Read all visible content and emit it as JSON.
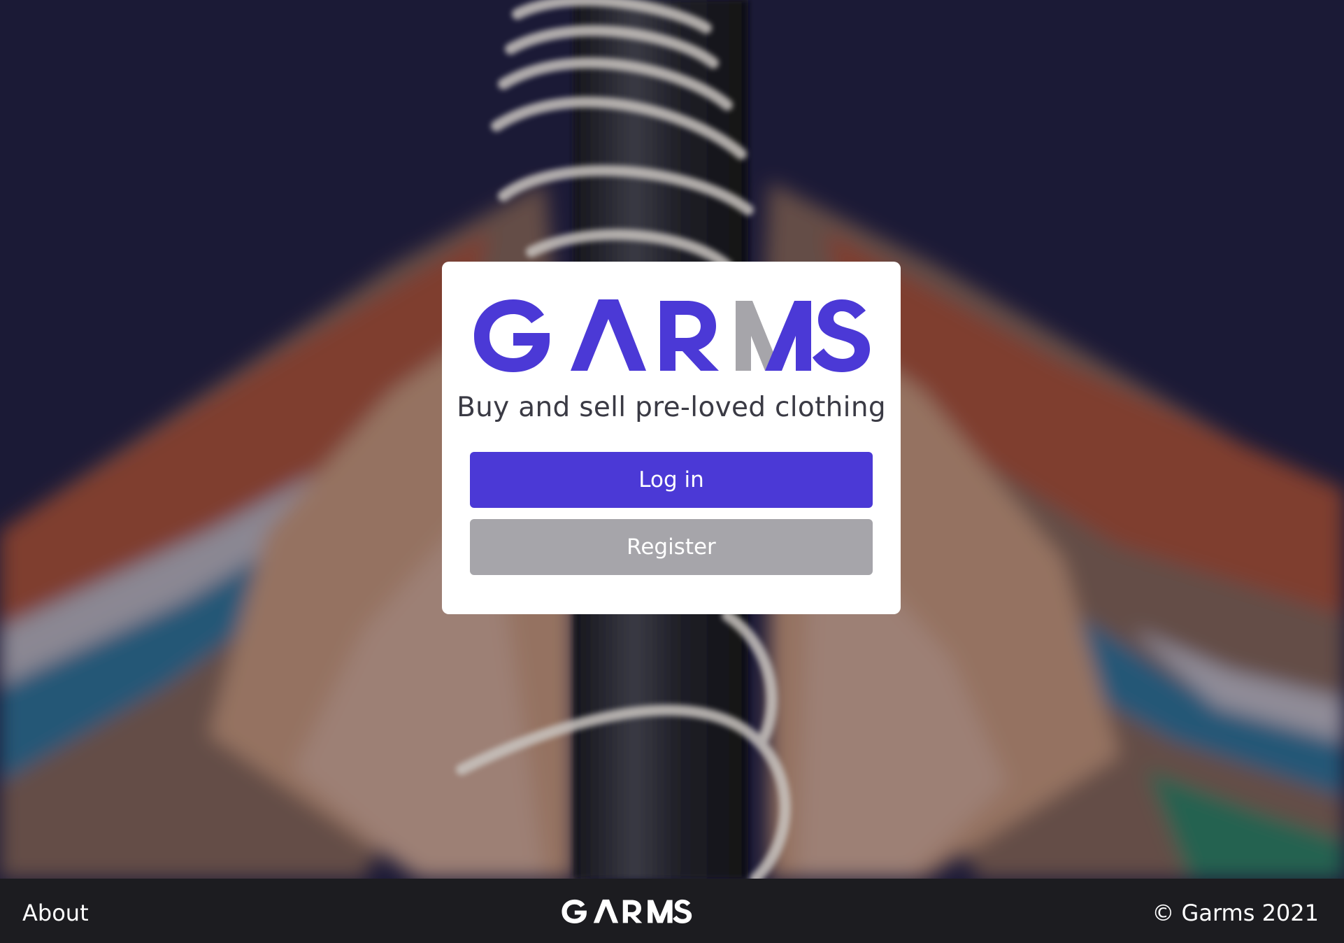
{
  "brand": {
    "logo_text": "GARMS",
    "primary_color": "#4b39d6",
    "accent_gray": "#a6a5aa"
  },
  "card": {
    "tagline": "Buy and sell pre-loved clothing",
    "login_label": "Log in",
    "register_label": "Register"
  },
  "footer": {
    "about_label": "About",
    "logo_text": "GARMS",
    "copyright": "© Garms 2021"
  },
  "hero": {
    "description_icon": "clothes-rack-photo"
  }
}
